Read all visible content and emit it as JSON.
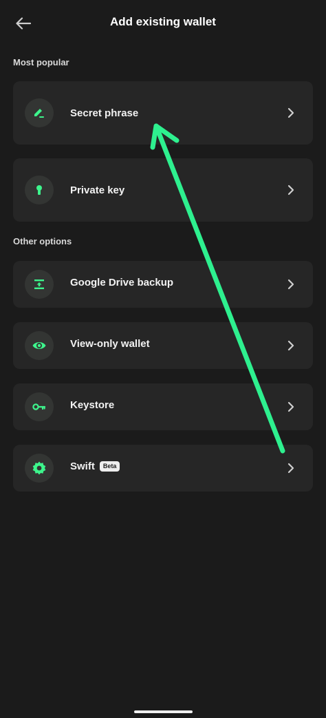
{
  "header": {
    "title": "Add existing wallet",
    "back_icon": "arrow-left-icon"
  },
  "sections": {
    "most_popular": "Most popular",
    "other_options": "Other options"
  },
  "options": {
    "secret_phrase": {
      "label": "Secret phrase",
      "icon": "pen-edit-icon"
    },
    "private_key": {
      "label": "Private key",
      "icon": "keyhole-icon"
    },
    "google_drive": {
      "label": "Google Drive backup",
      "icon": "drive-restore-icon"
    },
    "view_only": {
      "label": "View-only wallet",
      "icon": "eye-icon"
    },
    "keystore": {
      "label": "Keystore",
      "icon": "key-icon"
    },
    "swift": {
      "label": "Swift",
      "badge": "Beta",
      "icon": "badge-gear-icon"
    }
  },
  "colors": {
    "background": "#1b1b1b",
    "card": "#262626",
    "accent": "#3df58c",
    "annotation_arrow": "#2ef08f"
  }
}
